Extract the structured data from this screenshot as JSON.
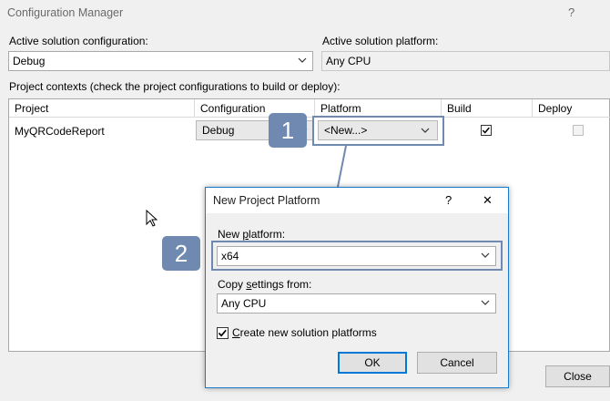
{
  "window": {
    "title": "Configuration Manager",
    "help": "?"
  },
  "active_config": {
    "label": "Active solution configuration:",
    "value": "Debug"
  },
  "active_platform": {
    "label": "Active solution platform:",
    "value": "Any CPU"
  },
  "project_contexts": {
    "label": "Project contexts (check the project configurations to build or deploy):",
    "columns": [
      "Project",
      "Configuration",
      "Platform",
      "Build",
      "Deploy"
    ],
    "rows": [
      {
        "project": "MyQRCodeReport",
        "configuration": "Debug",
        "platform": "<New...>",
        "build": true,
        "deploy": false
      }
    ]
  },
  "callouts": [
    "1",
    "2"
  ],
  "dialog": {
    "title": "New Project Platform",
    "help": "?",
    "close": "✕",
    "new_platform_label_prefix": "New ",
    "new_platform_label_accel": "p",
    "new_platform_label_suffix": "latform:",
    "new_platform_value": "x64",
    "copy_label_prefix": "Copy ",
    "copy_label_accel": "s",
    "copy_label_suffix": "ettings from:",
    "copy_value": "Any CPU",
    "create_accel": "C",
    "create_suffix": "reate new solution platforms",
    "create_checked": true,
    "ok_label": "OK",
    "cancel_label": "Cancel"
  },
  "close_button": "Close",
  "colors": {
    "callout": "#6f89b0",
    "dialog_border": "#1979ca",
    "default_button": "#0078d7"
  }
}
